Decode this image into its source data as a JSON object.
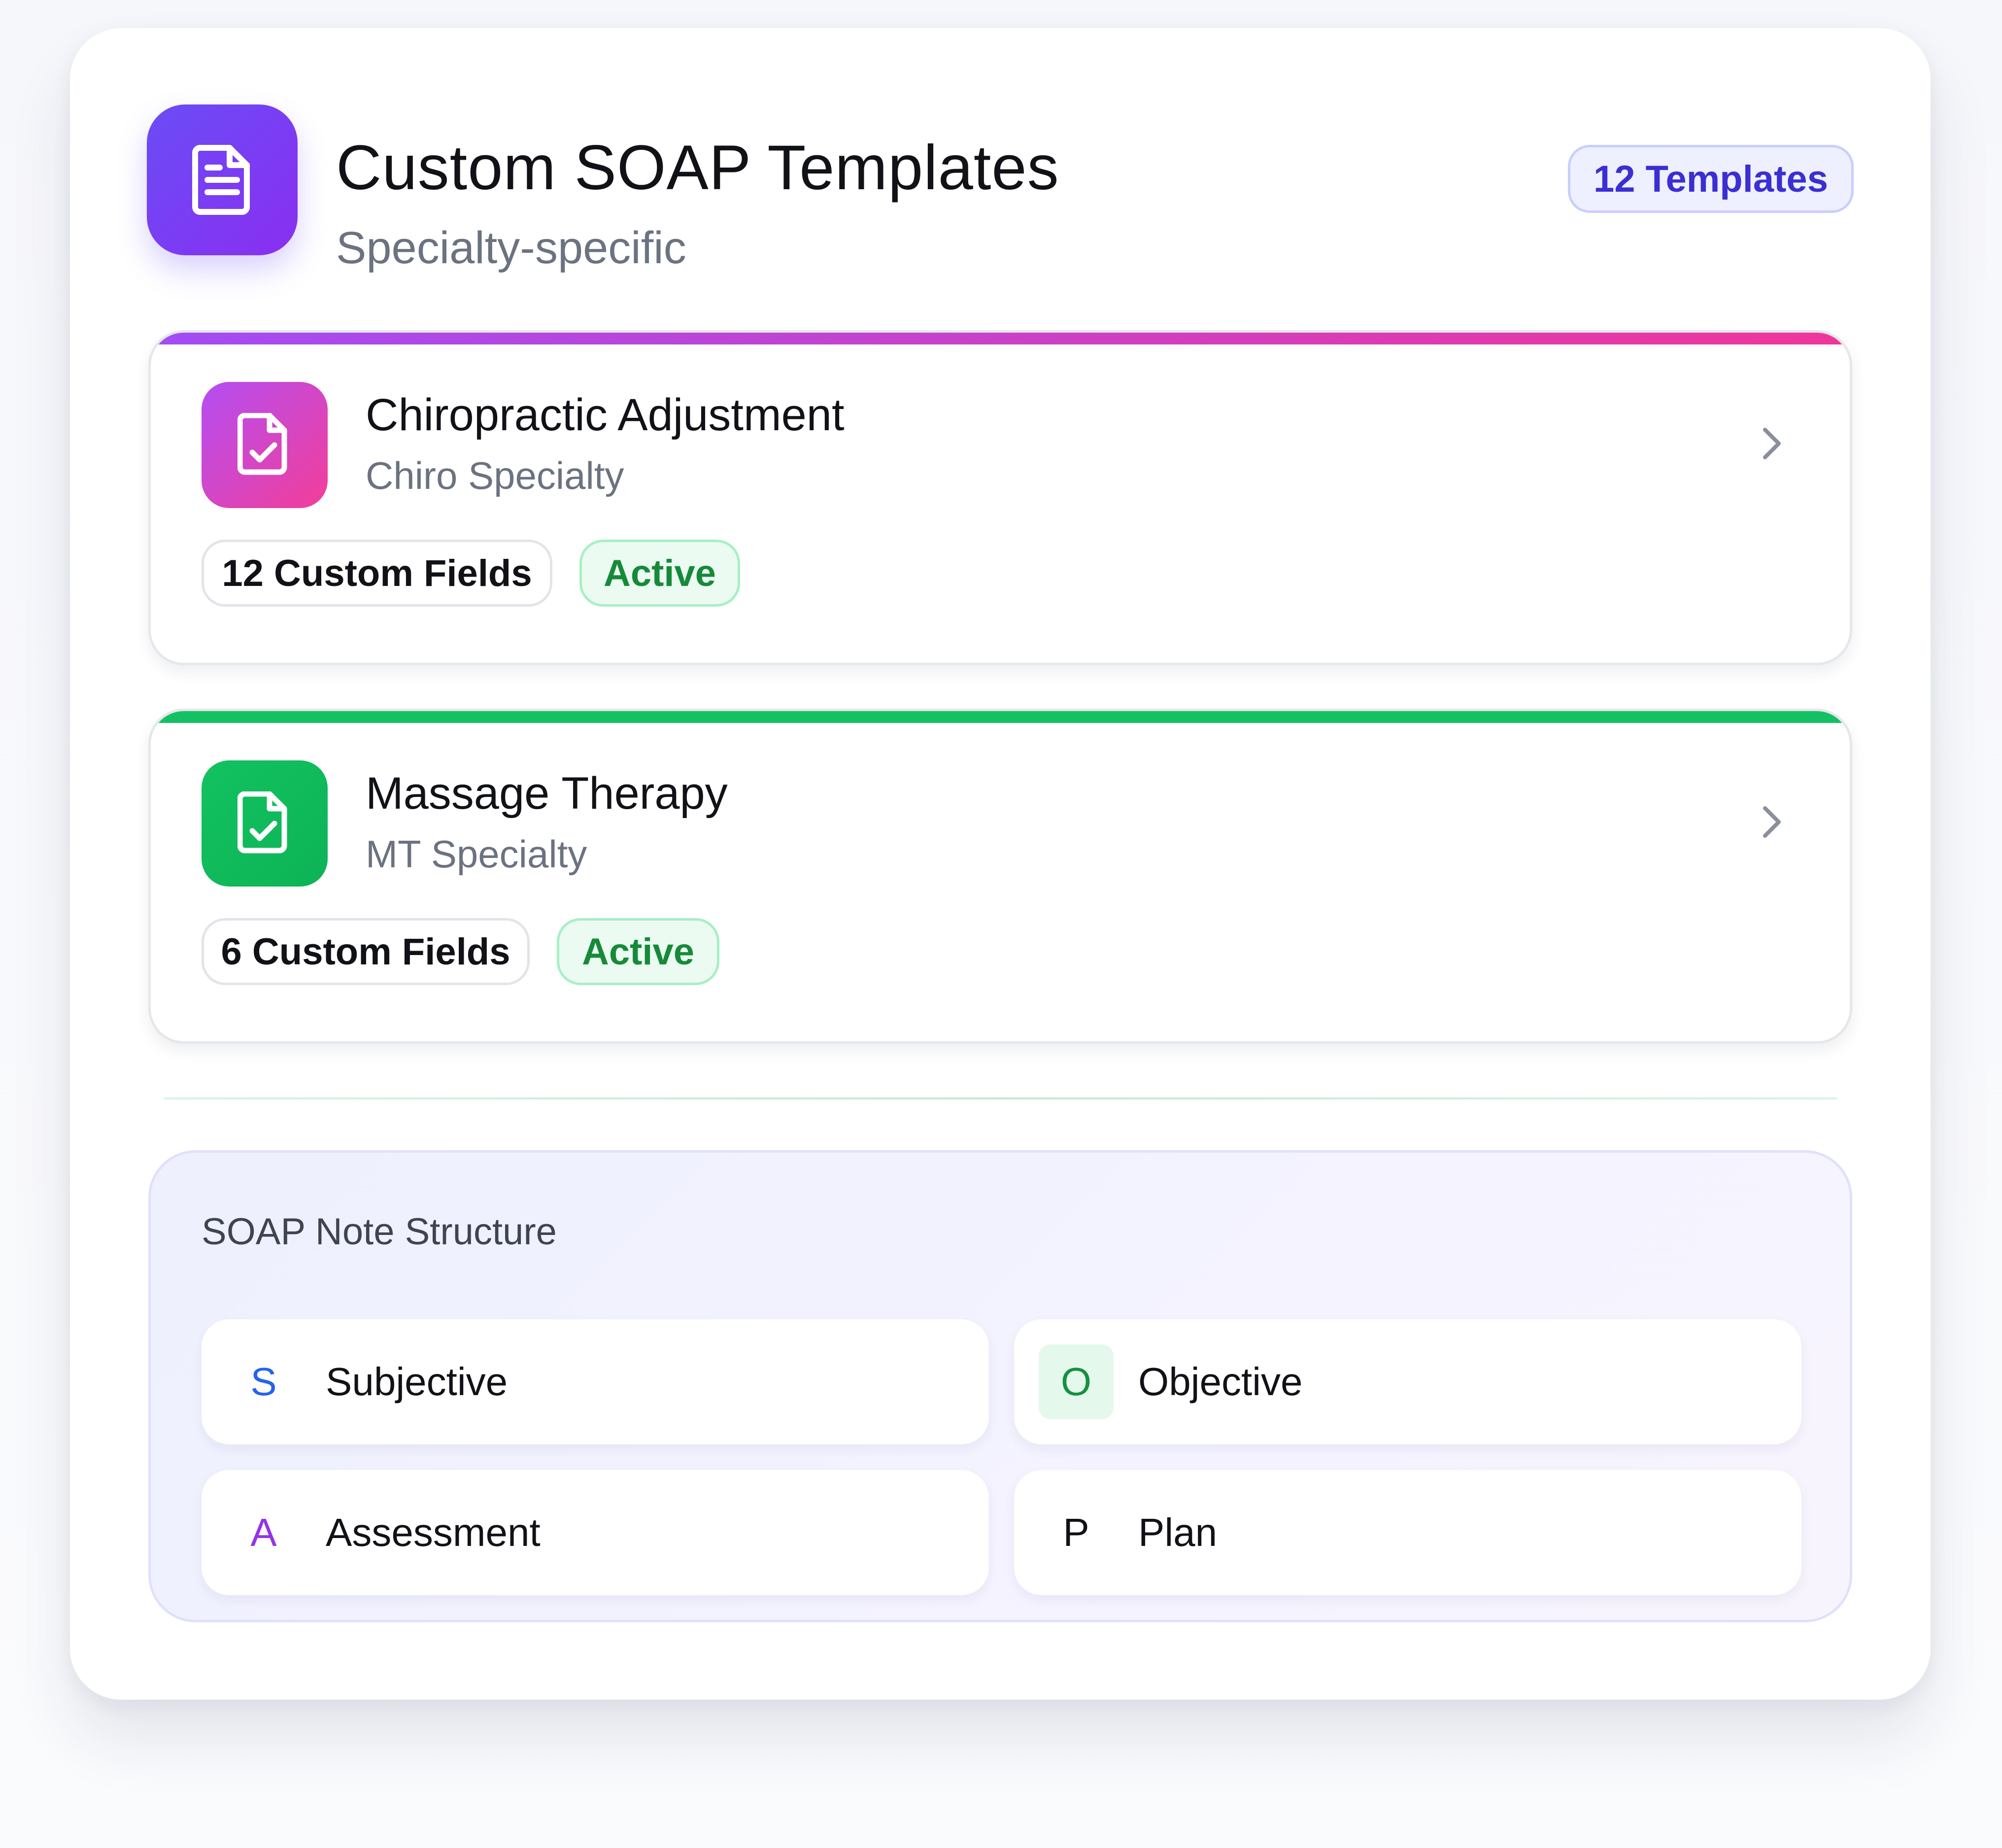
{
  "header": {
    "title": "Custom SOAP Templates",
    "subtitle": "Specialty-specific",
    "count_badge": "12 Templates",
    "icon": "document-icon"
  },
  "templates": [
    {
      "name": "Chiropractic Adjustment",
      "specialty": "Chiro Specialty",
      "fields": "12 Custom Fields",
      "status": "Active",
      "icon": "file-check-icon",
      "accent_from": "#a24cf5",
      "accent_to": "#f0369a"
    },
    {
      "name": "Massage Therapy",
      "specialty": "MT Specialty",
      "fields": "6 Custom Fields",
      "status": "Active",
      "icon": "file-check-icon",
      "accent_from": "#13c163",
      "accent_to": "#13c163"
    }
  ],
  "soap": {
    "title": "SOAP Note Structure",
    "sections": [
      {
        "letter": "S",
        "label": "Subjective",
        "color": "#2563eb"
      },
      {
        "letter": "O",
        "label": "Objective",
        "color": "#15913f"
      },
      {
        "letter": "A",
        "label": "Assessment",
        "color": "#9333ea"
      },
      {
        "letter": "P",
        "label": "Plan",
        "color": "#111217"
      }
    ]
  },
  "colors": {
    "brand_primary": "#6a4cf6",
    "active_green": "#178a3a",
    "badge_text": "#3b2fd1"
  }
}
